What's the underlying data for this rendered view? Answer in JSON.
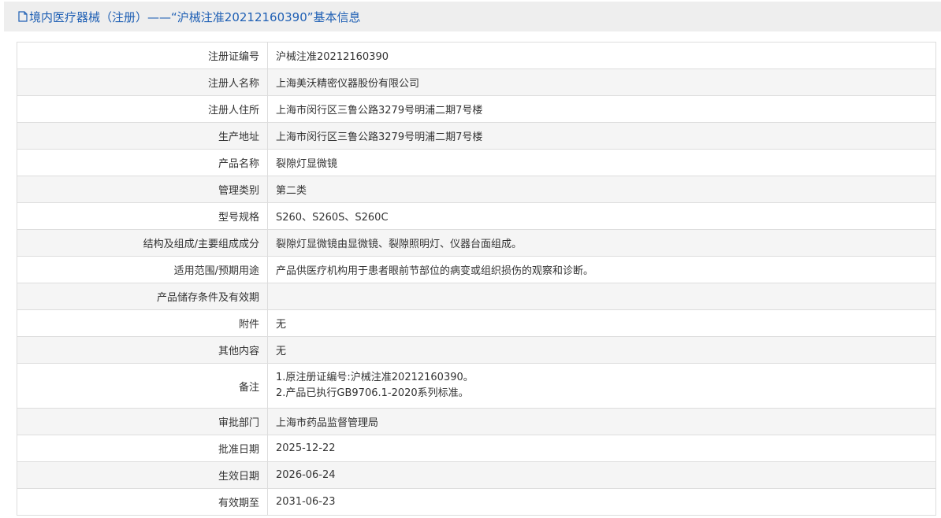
{
  "header": {
    "title": "境内医疗器械（注册）——“沪械注准20212160390”基本信息"
  },
  "rows": [
    {
      "label": "注册证编号",
      "value": "沪械注准20212160390"
    },
    {
      "label": "注册人名称",
      "value": "上海美沃精密仪器股份有限公司"
    },
    {
      "label": "注册人住所",
      "value": "上海市闵行区三鲁公路3279号明浦二期7号楼"
    },
    {
      "label": "生产地址",
      "value": "上海市闵行区三鲁公路3279号明浦二期7号楼"
    },
    {
      "label": "产品名称",
      "value": "裂隙灯显微镜"
    },
    {
      "label": "管理类别",
      "value": "第二类"
    },
    {
      "label": "型号规格",
      "value": "S260、S260S、S260C"
    },
    {
      "label": "结构及组成/主要组成成分",
      "value": "裂隙灯显微镜由显微镜、裂隙照明灯、仪器台面组成。"
    },
    {
      "label": "适用范围/预期用途",
      "value": "产品供医疗机构用于患者眼前节部位的病变或组织损伤的观察和诊断。"
    },
    {
      "label": "产品储存条件及有效期",
      "value": ""
    },
    {
      "label": "附件",
      "value": "无"
    },
    {
      "label": "其他内容",
      "value": "无"
    },
    {
      "label": "备注",
      "value_line1": "1.原注册证编号:沪械注准20212160390。",
      "value_line2": "2.产品已执行GB9706.1-2020系列标准。"
    },
    {
      "label": "审批部门",
      "value": "上海市药品监督管理局"
    },
    {
      "label": "批准日期",
      "value": "2025-12-22"
    },
    {
      "label": "生效日期",
      "value": "2026-06-24"
    },
    {
      "label": "有效期至",
      "value": "2031-06-23"
    }
  ],
  "colors": {
    "title": "#1e5fb4",
    "header_bg": "#eeeeee",
    "border": "#dddddd",
    "alt_row": "#f5f5f5"
  }
}
